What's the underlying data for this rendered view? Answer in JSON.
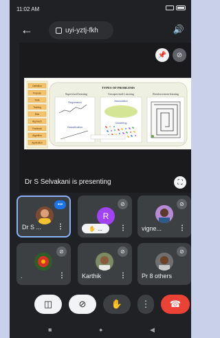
{
  "status": {
    "time": "11:02 AM"
  },
  "header": {
    "meeting_code": "uyi-yztj-fkh"
  },
  "presentation": {
    "label": "Dr S Selvakani is presenting",
    "slide": {
      "title": "TYPES OF PROBLEMS",
      "columns": [
        "Supervised learning",
        "Unsupervised Learning",
        "Reinforcement learning"
      ],
      "sublabels": [
        "Regression",
        "Association",
        "Classification",
        "Clustering"
      ],
      "sidebar_items": [
        "Definition",
        "Purpose",
        "Data",
        "Training",
        "Bias",
        "Approach",
        "Feedback",
        "Algorithm",
        "Application"
      ]
    }
  },
  "participants": [
    {
      "name": "Dr S ...",
      "state": "speaking"
    },
    {
      "name": "",
      "initial": "R",
      "hand_label": "...",
      "state": "muted"
    },
    {
      "name": "vigne...",
      "state": "muted"
    },
    {
      "name": ".",
      "state": "muted"
    },
    {
      "name": "Karthik",
      "state": "muted"
    },
    {
      "name": "Pr",
      "extra": "8 others",
      "state": "muted"
    }
  ],
  "colors": {
    "end_call": "#ea4335",
    "accent": "#8ab4f8",
    "avatar_r": "#a142f4"
  }
}
